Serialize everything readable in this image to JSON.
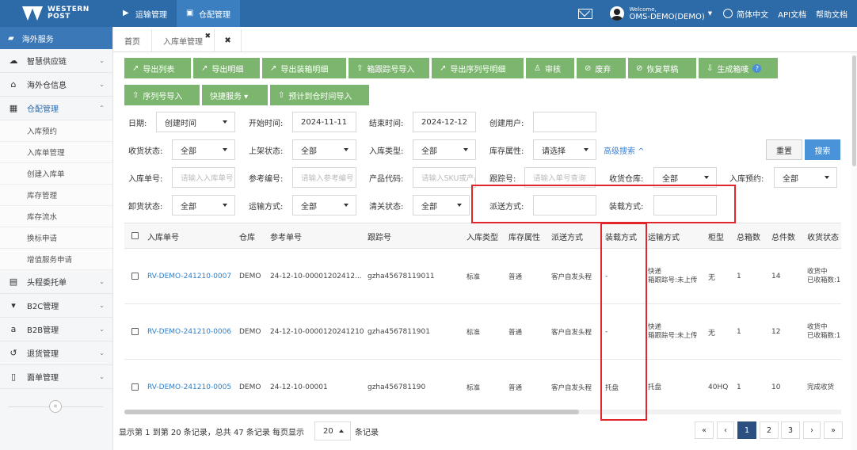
{
  "brand": {
    "line1": "WESTERN",
    "line2": "POST"
  },
  "topnav": [
    {
      "icon": "truck-icon",
      "glyph": "▶",
      "label": "运输管理"
    },
    {
      "icon": "warehouse-icon",
      "glyph": "▣",
      "label": "仓配管理"
    }
  ],
  "user": {
    "welcome": "Welcome,",
    "name": "OMS-DEMO(DEMO)"
  },
  "topright": {
    "lang": "简体中文",
    "api": "API文档",
    "help": "帮助文档"
  },
  "sidebar": {
    "header": "海外服务",
    "items": [
      {
        "name": "sidebar-item-smart-supply",
        "icon": "cloud-icon",
        "glyph": "☁",
        "label": "智慧供应链",
        "chev": "⌄"
      },
      {
        "name": "sidebar-item-overseas-info",
        "icon": "home-icon",
        "glyph": "⌂",
        "label": "海外仓信息",
        "chev": "⌄"
      },
      {
        "name": "sidebar-item-warehouse-mgmt",
        "icon": "grid-icon",
        "glyph": "▦",
        "label": "仓配管理",
        "chev": "⌃"
      }
    ],
    "subitems": [
      "入库预约",
      "入库单管理",
      "创建入库单",
      "库存管理",
      "库存流水",
      "换标申请",
      "增值服务申请"
    ],
    "items2": [
      {
        "name": "sidebar-item-first-leg",
        "icon": "briefcase-icon",
        "glyph": "▤",
        "label": "头程委托单",
        "chev": "⌄"
      },
      {
        "name": "sidebar-item-b2c",
        "icon": "cart-icon",
        "glyph": "▾",
        "label": "B2C管理",
        "chev": "⌄"
      },
      {
        "name": "sidebar-item-b2b",
        "icon": "amazon-icon",
        "glyph": "a",
        "label": "B2B管理",
        "chev": "⌄"
      },
      {
        "name": "sidebar-item-returns",
        "icon": "return-icon",
        "glyph": "↺",
        "label": "退货管理",
        "chev": "⌄"
      },
      {
        "name": "sidebar-item-sheets",
        "icon": "document-icon",
        "glyph": "▯",
        "label": "面单管理",
        "chev": "⌄"
      }
    ],
    "collapse": "«"
  },
  "tabs": {
    "home": "首页",
    "inbound": "入库单管理",
    "x": "✖",
    "close": "✖"
  },
  "toolbar": {
    "row1": [
      {
        "name": "export-list-button",
        "glyph": "↗",
        "label": "导出列表"
      },
      {
        "name": "export-detail-button",
        "glyph": "↗",
        "label": "导出明细"
      },
      {
        "name": "export-packing-button",
        "glyph": "↗",
        "label": "导出装箱明细"
      },
      {
        "name": "import-box-tracking-button",
        "glyph": "⇧",
        "label": "箱跟踪号导入"
      },
      {
        "name": "export-serial-button",
        "glyph": "↗",
        "label": "导出序列号明细"
      },
      {
        "name": "audit-button",
        "glyph": "♙",
        "label": "审核"
      },
      {
        "name": "discard-button",
        "glyph": "⊘",
        "label": "废弃"
      },
      {
        "name": "restore-draft-button",
        "glyph": "⊘",
        "label": "恢复草稿"
      },
      {
        "name": "generate-box-label-button",
        "glyph": "⇩",
        "label": "生成箱唛",
        "help": "?"
      }
    ],
    "row2": [
      {
        "name": "import-serial-button",
        "glyph": "⇧",
        "label": "序列号导入"
      },
      {
        "name": "quick-service-button",
        "glyph": "",
        "label": "快捷服务 ▾"
      },
      {
        "name": "import-eta-button",
        "glyph": "⇧",
        "label": "预计到仓时间导入"
      }
    ]
  },
  "filters": {
    "date_label": "日期:",
    "date_type": "创建时间",
    "start_label": "开始时间:",
    "start_value": "2024-11-11",
    "end_label": "结束时间:",
    "end_value": "2024-12-12",
    "creator_label": "创建用户:",
    "recv_status_label": "收货状态:",
    "recv_status": "全部",
    "shelf_status_label": "上架状态:",
    "shelf_status": "全部",
    "inbound_type_label": "入库类型:",
    "inbound_type": "全部",
    "stock_attr_label": "库存属性:",
    "stock_attr": "请选择",
    "advanced": "高级搜索 ^",
    "reset": "重置",
    "search": "搜索",
    "order_no_label": "入库单号:",
    "order_no_ph": "请输入入库单号",
    "ref_no_label": "参考编号:",
    "ref_no_ph": "请输入参考编号",
    "sku_label": "产品代码:",
    "sku_ph": "请输入SKU或产品代码",
    "tracking_label": "跟踪号:",
    "tracking_ph": "请输入单号查询",
    "recv_wh_label": "收货仓库:",
    "recv_wh": "全部",
    "reservation_label": "入库预约:",
    "reservation": "全部",
    "unload_label": "卸货状态:",
    "unload": "全部",
    "shipping_label": "运输方式:",
    "shipping": "全部",
    "customs_label": "清关状态:",
    "customs": "全部",
    "delivery_label": "派送方式:",
    "loading_label": "装载方式:"
  },
  "table": {
    "headers": [
      "入库单号",
      "仓库",
      "参考单号",
      "跟踪号",
      "入库类型",
      "库存属性",
      "派送方式",
      "装载方式",
      "运输方式",
      "柜型",
      "总箱数",
      "总件数",
      "收货状态"
    ],
    "rows": [
      {
        "order": "RV-DEMO-241210-0007",
        "wh": "DEMO",
        "ref": "24-12-10-00001202412...",
        "track": "gzha45678119011",
        "type": "标准",
        "attr": "普通",
        "delivery": "客户自发头程",
        "loading": "-",
        "ship1": "快递",
        "ship2": "箱跟踪号:未上传",
        "cabinet": "无",
        "boxes": "1",
        "pieces": "14",
        "status1": "收货中",
        "status2": "已收箱数:1"
      },
      {
        "order": "RV-DEMO-241210-0006",
        "wh": "DEMO",
        "ref": "24-12-10-0000120241210",
        "track": "gzha4567811901",
        "type": "标准",
        "attr": "普通",
        "delivery": "客户自发头程",
        "loading": "-",
        "ship1": "快递",
        "ship2": "箱跟踪号:未上传",
        "cabinet": "无",
        "boxes": "1",
        "pieces": "12",
        "status1": "收货中",
        "status2": "已收箱数:1"
      },
      {
        "order": "RV-DEMO-241210-0005",
        "wh": "DEMO",
        "ref": "24-12-10-00001",
        "track": "gzha456781190",
        "type": "标准",
        "attr": "普通",
        "delivery": "客户自发头程",
        "loading": "托盘",
        "ship1": "托盘",
        "ship2": "",
        "cabinet": "40HQ",
        "boxes": "1",
        "pieces": "10",
        "status1": "完成收货",
        "status2": ""
      }
    ]
  },
  "footer": {
    "text_a": "显示第 1 到第 20 条记录，总共 47 条记录 每页显示",
    "page_size": "20",
    "text_b": "条记录",
    "pages": [
      "«",
      "‹",
      "1",
      "2",
      "3",
      "›",
      "»"
    ],
    "current_page": "1"
  },
  "colors": {
    "topbar": "#2d6aa8",
    "toolbar_green": "#7cb66e",
    "link_blue": "#2e7fc8",
    "highlight_red": "#e0262b"
  }
}
